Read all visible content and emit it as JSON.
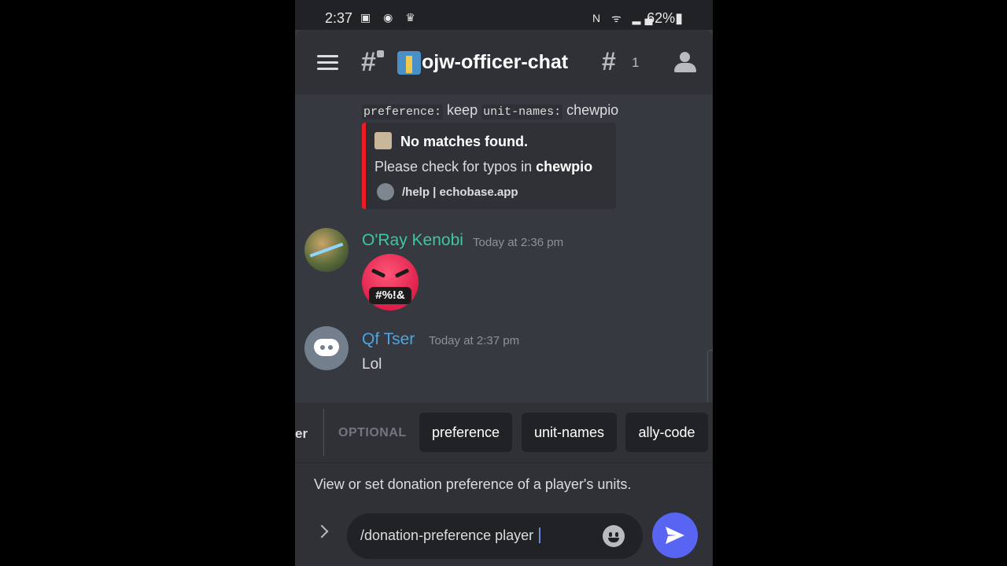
{
  "status_bar": {
    "time": "2:37",
    "left_icons": "▣ ◉ ♛",
    "right_icons": "N ᯤ ▂▄",
    "battery": "62%▮"
  },
  "header": {
    "channel_prefix": "#",
    "channel_name": "ojw-officer-chat",
    "thread_icon": "#",
    "thread_count": "1"
  },
  "messages": {
    "command_line": {
      "opt1_name": "preference:",
      "opt1_value": "keep",
      "opt2_name": "unit-names:",
      "opt2_value": "chewpio"
    },
    "embed": {
      "title": "No matches found.",
      "description_prefix": "Please check for typos in ",
      "description_bold": "chewpio",
      "footer": "/help | echobase.app",
      "accent_color": "#ed1c24"
    },
    "items": [
      {
        "author": "O'Ray Kenobi",
        "timestamp": "Today at 2:36 pm",
        "emoji_text": "#%!&"
      },
      {
        "author": "Qf Tser",
        "timestamp": "Today at 2:37 pm",
        "text": "Lol"
      }
    ]
  },
  "options_bar": {
    "partial_label": "er",
    "optional_label": "OPTIONAL",
    "chips": [
      "preference",
      "unit-names",
      "ally-code"
    ]
  },
  "command_description": "View or set donation preference of a player's units.",
  "composer": {
    "value": "/donation-preference player "
  },
  "colors": {
    "background": "#36393f",
    "accent": "#5865f2",
    "author1": "#3fc6a0",
    "author2": "#4fa3e0"
  }
}
